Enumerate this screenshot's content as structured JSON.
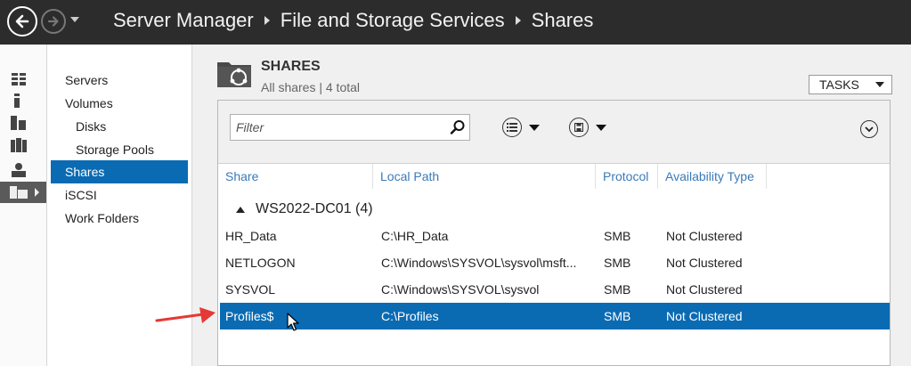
{
  "titlebar": {
    "breadcrumb": [
      "Server Manager",
      "File and Storage Services",
      "Shares"
    ]
  },
  "iconrail": {
    "items": [
      {
        "icon": "dashboard-icon"
      },
      {
        "icon": "local-server-icon"
      },
      {
        "icon": "all-servers-icon"
      },
      {
        "icon": "server-group-icon"
      },
      {
        "icon": "user-role-icon"
      },
      {
        "icon": "file-storage-icon",
        "active": true
      }
    ]
  },
  "subnav": {
    "items": [
      {
        "label": "Servers"
      },
      {
        "label": "Volumes"
      },
      {
        "label": "Disks",
        "indent": true
      },
      {
        "label": "Storage Pools",
        "indent": true
      },
      {
        "label": "Shares",
        "active": true
      },
      {
        "label": "iSCSI"
      },
      {
        "label": "Work Folders"
      }
    ]
  },
  "tile": {
    "title": "SHARES",
    "subtitle": "All shares | 4 total",
    "tasks_label": "TASKS"
  },
  "toolbar": {
    "filter_placeholder": "Filter"
  },
  "table": {
    "columns": [
      "Share",
      "Local Path",
      "Protocol",
      "Availability Type"
    ],
    "group_label": "WS2022-DC01 (4)",
    "rows": [
      {
        "share": "HR_Data",
        "path": "C:\\HR_Data",
        "protocol": "SMB",
        "availability": "Not Clustered"
      },
      {
        "share": "NETLOGON",
        "path": "C:\\Windows\\SYSVOL\\sysvol\\msft...",
        "protocol": "SMB",
        "availability": "Not Clustered"
      },
      {
        "share": "SYSVOL",
        "path": "C:\\Windows\\SYSVOL\\sysvol",
        "protocol": "SMB",
        "availability": "Not Clustered"
      },
      {
        "share": "Profiles$",
        "path": "C:\\Profiles",
        "protocol": "SMB",
        "availability": "Not Clustered",
        "selected": true
      }
    ]
  },
  "colors": {
    "titlebar_bg": "#2c2c2c",
    "selection": "#0a6bb3",
    "header_text": "#3a7ab8",
    "annotation_arrow": "#e53935"
  }
}
